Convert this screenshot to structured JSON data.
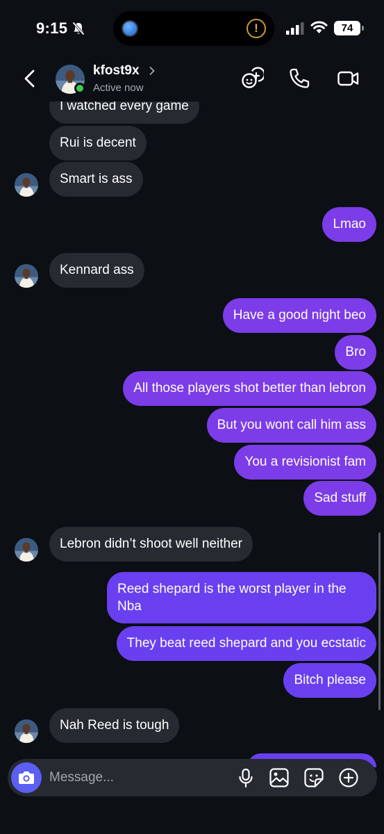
{
  "status_bar": {
    "time": "9:15",
    "battery": "74"
  },
  "header": {
    "name": "kfost9x",
    "status": "Active now"
  },
  "messages": [
    {
      "side": "in",
      "text": "I watched every game"
    },
    {
      "side": "in",
      "text": "Rui is decent"
    },
    {
      "side": "in",
      "text": "Smart is ass"
    },
    {
      "side": "out",
      "text": "Lmao"
    },
    {
      "side": "in",
      "text": "Kennard ass"
    },
    {
      "side": "out",
      "text": "Have a good night beo"
    },
    {
      "side": "out",
      "text": "Bro"
    },
    {
      "side": "out",
      "text": "All those players shot better than lebron"
    },
    {
      "side": "out",
      "text": "But you wont call him ass"
    },
    {
      "side": "out",
      "text": "You a revisionist fam"
    },
    {
      "side": "out",
      "text": "Sad stuff"
    },
    {
      "side": "in",
      "text": "Lebron didn’t shoot well neither"
    },
    {
      "side": "out",
      "text": "Reed shepard is the worst player in the Nba"
    },
    {
      "side": "out",
      "text": "They beat reed shepard and you ecstatic"
    },
    {
      "side": "out",
      "text": "Bitch please"
    },
    {
      "side": "in",
      "text": "Nah Reed is tough"
    }
  ],
  "composer": {
    "placeholder": "Message..."
  },
  "colors": {
    "outgoing": "#7c3ce8",
    "outgoing_late": "#6a3ff0",
    "incoming": "#262a31",
    "background": "#0c0f14",
    "online": "#3fcb4f"
  },
  "icons": [
    "back-icon",
    "video-chat-effects-icon",
    "phone-icon",
    "video-call-icon",
    "camera-icon",
    "microphone-icon",
    "gallery-icon",
    "sticker-icon",
    "plus-icon"
  ]
}
